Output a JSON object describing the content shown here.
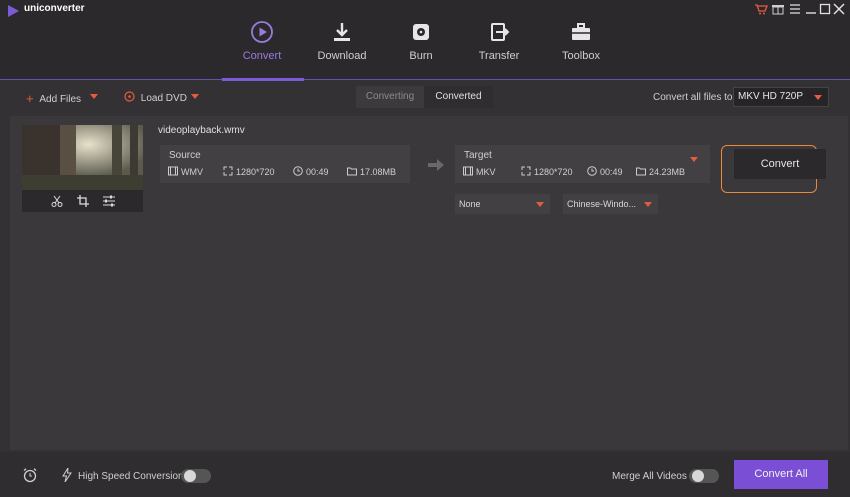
{
  "app": {
    "title": "uniconverter"
  },
  "nav": {
    "tabs": [
      {
        "label": "Convert",
        "icon": "play-circle-icon",
        "active": true
      },
      {
        "label": "Download",
        "icon": "download-icon",
        "active": false
      },
      {
        "label": "Burn",
        "icon": "disc-icon",
        "active": false
      },
      {
        "label": "Transfer",
        "icon": "transfer-icon",
        "active": false
      },
      {
        "label": "Toolbox",
        "icon": "toolbox-icon",
        "active": false
      }
    ]
  },
  "toolbar": {
    "add_files": "Add Files",
    "load_dvd": "Load DVD",
    "segments": {
      "converting": "Converting",
      "converted": "Converted"
    },
    "convert_all_to_label": "Convert all files to:",
    "format_selected": "MKV HD 720P"
  },
  "file": {
    "name": "videoplayback.wmv",
    "source": {
      "title": "Source",
      "format": "WMV",
      "resolution": "1280*720",
      "duration": "00:49",
      "size": "17.08MB"
    },
    "target": {
      "title": "Target",
      "format": "MKV",
      "resolution": "1280*720",
      "duration": "00:49",
      "size": "24.23MB"
    },
    "subtitle_select": "None",
    "audio_select": "Chinese-Windo...",
    "convert_button": "Convert"
  },
  "footer": {
    "high_speed_label": "High Speed Conversion",
    "merge_label": "Merge All Videos",
    "convert_all_button": "Convert All"
  },
  "colors": {
    "accent": "#7a4fd6",
    "caret": "#e55b3f",
    "highlight_ring": "#e88a3a"
  }
}
